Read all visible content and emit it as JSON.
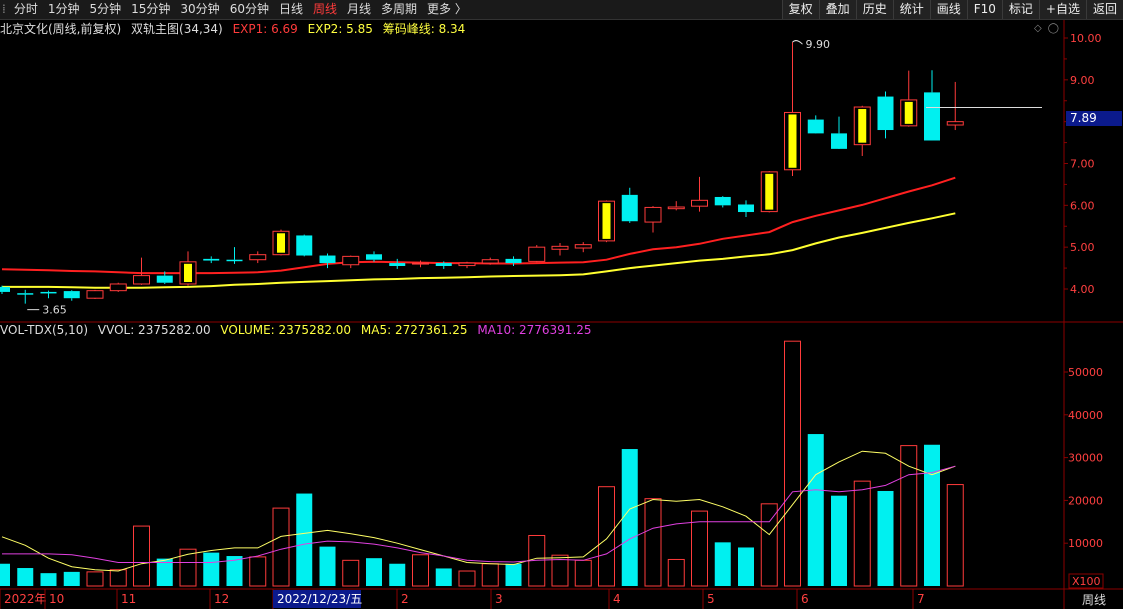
{
  "toolbar": {
    "periods": [
      "分时",
      "1分钟",
      "5分钟",
      "15分钟",
      "30分钟",
      "60分钟",
      "日线",
      "周线",
      "月线",
      "多周期",
      "更多 〉"
    ],
    "active_period": "周线",
    "tools": [
      "复权",
      "叠加",
      "历史",
      "统计",
      "画线",
      "F10",
      "标记",
      "+自选",
      "返回"
    ]
  },
  "main_info": {
    "stock": "北京文化(周线,前复权)",
    "indicator": "双轨主图(34,34)",
    "exp1": "EXP1: 6.69",
    "exp2": "EXP2: 5.85",
    "chip": "筹码峰线: 8.34"
  },
  "vol_info": {
    "name": "VOL-TDX(5,10)",
    "vvol": "VVOL: 2375282.00",
    "volume": "VOLUME: 2375282.00",
    "ma5": "MA5: 2727361.25",
    "ma10": "MA10: 2776391.25"
  },
  "price_axis_labels": [
    "10.00",
    "9.00",
    "8.00",
    "7.00",
    "6.00",
    "5.00",
    "4.00"
  ],
  "vol_axis_labels": [
    "50000",
    "40000",
    "30000",
    "20000",
    "10000"
  ],
  "vol_unit": "X100",
  "current_price": "7.89",
  "annotations": {
    "high": "9.90",
    "low": "3.65"
  },
  "x_labels": [
    "2022年",
    "10",
    "11",
    "12",
    "2022/12/23/五",
    "2",
    "3",
    "4",
    "5",
    "6",
    "7"
  ],
  "period_label": "周线",
  "colors": {
    "up": "#ff3b3b",
    "down": "#00f0f0",
    "ma_red": "#ff2020",
    "ma_yellow": "#ffff30",
    "grid": "#8b0000",
    "vol_ma5": "#ffff66",
    "vol_ma10": "#e040e0",
    "label": "#ff4040",
    "box": "#ffff00"
  },
  "chart_data": {
    "type": "candlestick",
    "candles": [
      {
        "o": 4.05,
        "h": 4.08,
        "l": 3.88,
        "c": 3.93
      },
      {
        "o": 3.9,
        "h": 3.98,
        "l": 3.65,
        "c": 3.88
      },
      {
        "o": 3.93,
        "h": 3.96,
        "l": 3.78,
        "c": 3.9
      },
      {
        "o": 3.95,
        "h": 3.97,
        "l": 3.72,
        "c": 3.78
      },
      {
        "o": 3.78,
        "h": 3.98,
        "l": 3.76,
        "c": 3.96
      },
      {
        "o": 3.96,
        "h": 4.15,
        "l": 3.93,
        "c": 4.12
      },
      {
        "o": 4.12,
        "h": 4.75,
        "l": 4.1,
        "c": 4.32
      },
      {
        "o": 4.32,
        "h": 4.42,
        "l": 4.12,
        "c": 4.15
      },
      {
        "o": 4.12,
        "h": 4.9,
        "l": 4.08,
        "c": 4.65
      },
      {
        "o": 4.72,
        "h": 4.78,
        "l": 4.62,
        "c": 4.68
      },
      {
        "o": 4.7,
        "h": 5.0,
        "l": 4.6,
        "c": 4.68
      },
      {
        "o": 4.7,
        "h": 4.9,
        "l": 4.62,
        "c": 4.82
      },
      {
        "o": 4.82,
        "h": 5.42,
        "l": 4.8,
        "c": 5.38
      },
      {
        "o": 5.28,
        "h": 5.3,
        "l": 4.78,
        "c": 4.8
      },
      {
        "o": 4.8,
        "h": 4.85,
        "l": 4.5,
        "c": 4.62
      },
      {
        "o": 4.58,
        "h": 4.8,
        "l": 4.5,
        "c": 4.78
      },
      {
        "o": 4.83,
        "h": 4.9,
        "l": 4.65,
        "c": 4.7
      },
      {
        "o": 4.62,
        "h": 4.72,
        "l": 4.48,
        "c": 4.55
      },
      {
        "o": 4.6,
        "h": 4.68,
        "l": 4.52,
        "c": 4.62
      },
      {
        "o": 4.62,
        "h": 4.66,
        "l": 4.48,
        "c": 4.55
      },
      {
        "o": 4.56,
        "h": 4.65,
        "l": 4.5,
        "c": 4.62
      },
      {
        "o": 4.62,
        "h": 4.75,
        "l": 4.58,
        "c": 4.7
      },
      {
        "o": 4.72,
        "h": 4.78,
        "l": 4.55,
        "c": 4.62
      },
      {
        "o": 4.66,
        "h": 5.05,
        "l": 4.64,
        "c": 5.0
      },
      {
        "o": 4.95,
        "h": 5.1,
        "l": 4.8,
        "c": 5.02
      },
      {
        "o": 4.98,
        "h": 5.12,
        "l": 4.88,
        "c": 5.06
      },
      {
        "o": 5.15,
        "h": 6.12,
        "l": 5.12,
        "c": 6.1
      },
      {
        "o": 6.25,
        "h": 6.42,
        "l": 5.58,
        "c": 5.62
      },
      {
        "o": 5.6,
        "h": 5.98,
        "l": 5.35,
        "c": 5.95
      },
      {
        "o": 5.92,
        "h": 6.1,
        "l": 5.88,
        "c": 5.96
      },
      {
        "o": 5.98,
        "h": 6.68,
        "l": 5.85,
        "c": 6.12
      },
      {
        "o": 6.2,
        "h": 6.22,
        "l": 5.95,
        "c": 6.0
      },
      {
        "o": 6.02,
        "h": 6.12,
        "l": 5.72,
        "c": 5.84
      },
      {
        "o": 5.85,
        "h": 6.82,
        "l": 5.83,
        "c": 6.8
      },
      {
        "o": 6.85,
        "h": 9.9,
        "l": 6.7,
        "c": 8.22
      },
      {
        "o": 8.05,
        "h": 8.15,
        "l": 7.8,
        "c": 7.72
      },
      {
        "o": 7.72,
        "h": 8.12,
        "l": 7.4,
        "c": 7.35
      },
      {
        "o": 7.45,
        "h": 8.38,
        "l": 7.18,
        "c": 8.35
      },
      {
        "o": 8.6,
        "h": 8.72,
        "l": 7.6,
        "c": 7.8
      },
      {
        "o": 7.9,
        "h": 9.22,
        "l": 7.88,
        "c": 8.52
      },
      {
        "o": 8.7,
        "h": 9.23,
        "l": 7.58,
        "c": 7.55
      },
      {
        "o": 7.92,
        "h": 8.95,
        "l": 7.8,
        "c": 8.0
      }
    ],
    "ma_red": [
      4.47,
      4.46,
      4.45,
      4.43,
      4.42,
      4.4,
      4.38,
      4.38,
      4.38,
      4.38,
      4.39,
      4.4,
      4.44,
      4.52,
      4.6,
      4.64,
      4.65,
      4.64,
      4.63,
      4.62,
      4.62,
      4.61,
      4.61,
      4.62,
      4.63,
      4.64,
      4.7,
      4.84,
      4.95,
      5.0,
      5.08,
      5.2,
      5.28,
      5.36,
      5.6,
      5.75,
      5.88,
      6.01,
      6.17,
      6.33,
      6.48,
      6.66
    ],
    "ma_yellow": [
      4.05,
      4.05,
      4.05,
      4.04,
      4.03,
      4.03,
      4.03,
      4.04,
      4.05,
      4.07,
      4.1,
      4.12,
      4.15,
      4.17,
      4.19,
      4.21,
      4.23,
      4.24,
      4.26,
      4.27,
      4.28,
      4.3,
      4.31,
      4.32,
      4.33,
      4.35,
      4.42,
      4.5,
      4.56,
      4.62,
      4.68,
      4.72,
      4.78,
      4.83,
      4.93,
      5.09,
      5.23,
      5.34,
      5.46,
      5.58,
      5.69,
      5.81
    ],
    "volumes": [
      5200,
      4200,
      3000,
      3300,
      3300,
      3800,
      14000,
      6400,
      8600,
      7800,
      7000,
      6800,
      18200,
      21600,
      9200,
      6000,
      6500,
      5200,
      7300,
      4100,
      3500,
      5200,
      5200,
      11800,
      7200,
      6000,
      23200,
      32000,
      20400,
      6200,
      17500,
      10200,
      9000,
      19200,
      57200,
      35500,
      21100,
      24500,
      22200,
      32800,
      33000,
      23700
    ],
    "vol_ma5": [
      11500,
      9500,
      6500,
      4500,
      3800,
      3500,
      5200,
      6000,
      7400,
      8300,
      8900,
      8900,
      11600,
      12300,
      13000,
      12200,
      11300,
      10000,
      8500,
      7000,
      5500,
      5200,
      5000,
      6500,
      6600,
      6800,
      11000,
      18000,
      20200,
      19800,
      20200,
      18500,
      16300,
      12000,
      19000,
      26000,
      29000,
      31500,
      31000,
      28000,
      26000,
      28000
    ],
    "vol_ma10": [
      7500,
      7500,
      7500,
      7300,
      6500,
      5500,
      5500,
      5500,
      5500,
      5500,
      6000,
      7000,
      8600,
      9800,
      10500,
      10300,
      9800,
      8900,
      7800,
      7000,
      6000,
      5700,
      5600,
      6000,
      6200,
      6000,
      7500,
      11000,
      13500,
      14500,
      15000,
      15000,
      15000,
      15000,
      22000,
      22500,
      22000,
      22500,
      23500,
      26000,
      26500,
      28000
    ],
    "price_range": [
      3.4,
      10.35
    ],
    "vol_range": [
      0,
      59000
    ]
  }
}
